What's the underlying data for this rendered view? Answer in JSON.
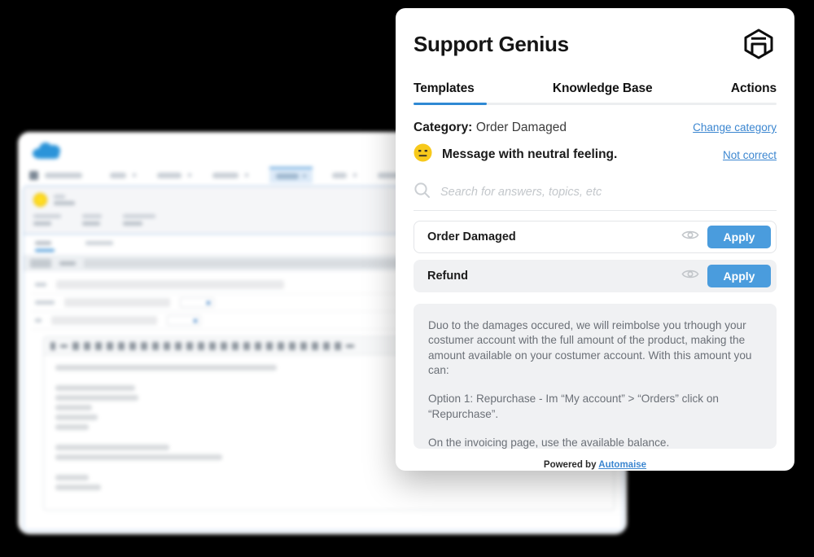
{
  "panel": {
    "title": "Support Genius",
    "logo_icon": "automaise-hexagon-logo",
    "tabs": [
      {
        "label": "Templates",
        "active": true
      },
      {
        "label": "Knowledge Base",
        "active": false
      },
      {
        "label": "Actions",
        "active": false
      }
    ],
    "category": {
      "label": "Category:",
      "value": "Order Damaged",
      "change_link": "Change category"
    },
    "sentiment": {
      "emoji_icon": "neutral-face-emoji",
      "text": "Message with neutral feeling.",
      "not_correct_link": "Not correct"
    },
    "search": {
      "icon": "search-icon",
      "placeholder": "Search for answers, topics, etc",
      "value": ""
    },
    "templates": [
      {
        "name": "Order Damaged",
        "eye_icon": "eye-icon",
        "apply_label": "Apply",
        "style": "white"
      },
      {
        "name": "Refund",
        "eye_icon": "eye-icon",
        "apply_label": "Apply",
        "style": "grey"
      }
    ],
    "preview": {
      "paragraph_1": "Duo to the damages occured, we will reimbolse you trhough your costumer account with the full amount of the product, making the amount available on your costumer account. With this amount you can:",
      "paragraph_2": "Option 1: Repurchase - Im “My account” > “Orders” click on “Repurchase”.",
      "paragraph_3": "On the invoicing page, use the available balance."
    },
    "footer": {
      "powered_by": "Powered by",
      "brand": "Automaise"
    },
    "colors": {
      "accent_blue": "#2f89d4",
      "apply_blue": "#4a9cdd",
      "link_blue": "#3b86d0",
      "emoji_yellow": "#f7c91b",
      "panel_bg": "#ffffff",
      "preview_bg": "#f0f1f3",
      "page_bg": "#000000"
    }
  },
  "background_window": {
    "description": "blurred CRM case record window",
    "logo_icon": "cloud-logo",
    "status_icon": "yellow-status-dot",
    "editor_toolbar_icon": "rich-text-toolbar-icon",
    "nav_tab_count": 9,
    "active_nav_tab_index": 4
  }
}
